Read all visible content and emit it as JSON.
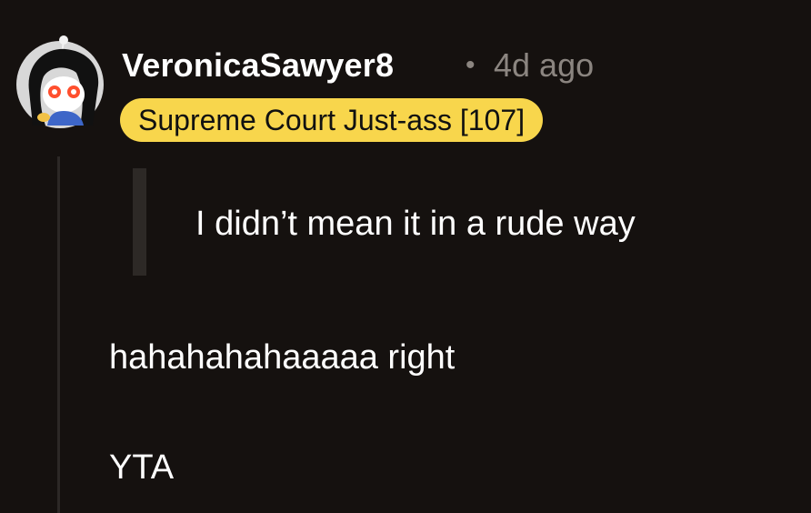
{
  "comment": {
    "username": "VeronicaSawyer8",
    "separator": "•",
    "timestamp": "4d ago",
    "flair": "Supreme Court Just-ass [107]",
    "avatar_icon": "reddit-snoo-avatar-icon",
    "quote": "I didn’t mean it in a rude way",
    "body": [
      "hahahahahaaaaa right",
      "YTA"
    ]
  },
  "colors": {
    "background": "#15110f",
    "flair_background": "#f8d64c",
    "meta_text": "#8b8580",
    "thread_line": "#2c2826"
  }
}
